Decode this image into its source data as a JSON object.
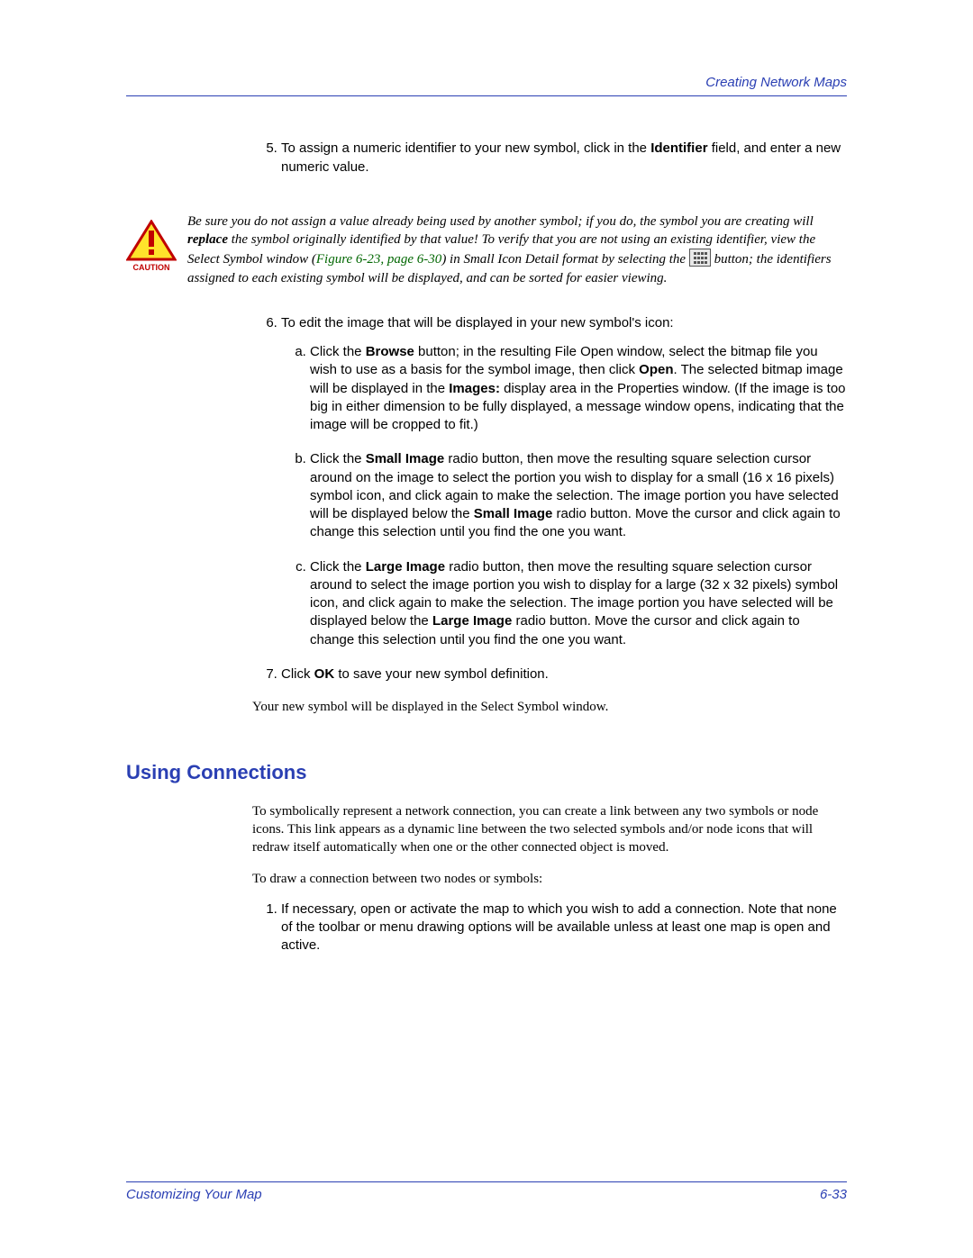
{
  "header": {
    "right_text": "Creating Network Maps"
  },
  "step5": {
    "pre": "To assign a numeric identifier to your new symbol, click in the ",
    "bold": "Identifier",
    "post": " field, and enter a new numeric value."
  },
  "caution": {
    "seg1": "Be sure you do not assign a value already being used by another symbol; if you do, the symbol you are creating will ",
    "bold1": "replace",
    "seg2": " the symbol originally identified by that value! To verify that you are not using an existing identifier, view the Select Symbol window (",
    "xref": "Figure 6-23, page 6-30",
    "seg3": ") in Small Icon Detail format by selecting the ",
    "seg4": " button; the identifiers assigned to each existing symbol will be displayed, and can be sorted for easier viewing."
  },
  "step6": {
    "intro": "To edit the image that will be displayed in your new symbol's icon:",
    "a": {
      "p1": "Click the ",
      "b1": "Browse",
      "p2": " button; in the resulting File Open window, select the bitmap file you wish to use as a basis for the symbol image, then click ",
      "b2": "Open",
      "p3": ". The selected bitmap image will be displayed in the ",
      "b3": "Images:",
      "p4": " display area in the Properties window. (If the image is too big in either dimension to be fully displayed, a message window opens, indicating that the image will be cropped to fit.)"
    },
    "b": {
      "p1": "Click the ",
      "b1": "Small Image",
      "p2": " radio button, then move the resulting square selection cursor around on the image to select the portion you wish to display for a small (16 x 16 pixels) symbol icon, and click again to make the selection. The image portion you have selected will be displayed below the ",
      "b2": "Small Image",
      "p3": " radio button. Move the cursor and click again to change this selection until you find the one you want."
    },
    "c": {
      "p1": "Click the ",
      "b1": "Large Image",
      "p2": " radio button, then move the resulting square selection cursor around to select the image portion you wish to display for a large (32 x 32 pixels) symbol icon, and click again to make the selection. The image portion you have selected will be displayed below the ",
      "b2": "Large Image",
      "p3": " radio button. Move the cursor and click again to change this selection until you find the one you want."
    }
  },
  "step7": {
    "p1": "Click ",
    "b1": "OK",
    "p2": " to save your new symbol definition."
  },
  "closing": "Your new symbol will be displayed in the Select Symbol window.",
  "section": {
    "heading": "Using Connections",
    "para1": "To symbolically represent a network connection, you can create a link between any two symbols or node icons. This link appears as a dynamic line between the two selected symbols and/or node icons that will redraw itself automatically when one or the other connected object is moved.",
    "para2": "To draw a connection between two nodes or symbols:",
    "step1": "If necessary, open or activate the map to which you wish to add a connection. Note that none of the toolbar or menu drawing options will be available unless at least one map is open and active."
  },
  "footer": {
    "left": "Customizing Your Map",
    "right": "6-33"
  }
}
